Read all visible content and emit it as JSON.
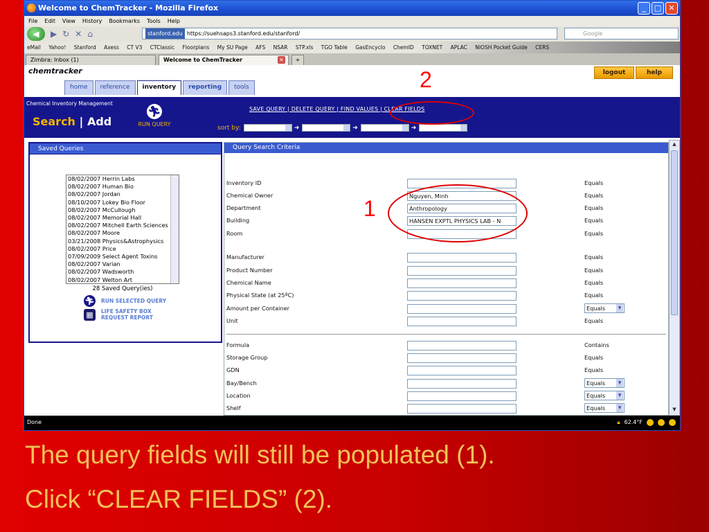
{
  "browser": {
    "title": "Welcome to ChemTracker - Mozilla Firefox",
    "menus": [
      "File",
      "Edit",
      "View",
      "History",
      "Bookmarks",
      "Tools",
      "Help"
    ],
    "url_chip": "stanford.edu",
    "url": "https://suehsaps3.stanford.edu/stanford/",
    "search_placeholder": "Google",
    "bookmarks": [
      "eMail",
      "Yahoo!",
      "Stanford",
      "Axess",
      "CT V3",
      "CTClassic",
      "Floorplans",
      "My SU Page",
      "AFS",
      "NSAR",
      "STP.xls",
      "TGO Table",
      "GasEncyclo",
      "ChemID",
      "TOXNET",
      "APLAC",
      "NIOSH Pocket Guide",
      "CERS"
    ],
    "tabs": [
      {
        "label": "Zimbra: Inbox (1)"
      },
      {
        "label": "Welcome to ChemTracker"
      }
    ],
    "status": "Done",
    "temperature": "62.4°F"
  },
  "app": {
    "logo": "chemtracker",
    "tabs": [
      "home",
      "reference",
      "inventory",
      "reporting",
      "tools"
    ],
    "logout": "logout",
    "help": "help",
    "section_title": "Chemical Inventory Management",
    "search": "Search",
    "separator": "|",
    "add": "Add",
    "run_query": "RUN QUERY",
    "links": "SAVE QUERY | DELETE QUERY | FIND VALUES | CLEAR FIELDS",
    "sort_by": "sort by:"
  },
  "saved_queries": {
    "header": "Saved Queries",
    "items": [
      "08/02/2007 Herrin Labs",
      "08/02/2007 Human Bio",
      "08/02/2007 Jordan",
      "08/10/2007 Lokey Bio Floor",
      "08/02/2007 McCullough",
      "08/02/2007 Memorial Hall",
      "08/02/2007 Mitchell Earth Sciences",
      "08/02/2007 Moore",
      "03/21/2008 Physics&Astrophysics",
      "08/02/2007 Price",
      "07/09/2009 Select Agent Toxins",
      "08/02/2007 Varian",
      "08/02/2007 Wadsworth",
      "08/02/2007 Welton Art"
    ],
    "count": "28 Saved Query(ies)",
    "run_selected": "RUN SELECTED QUERY",
    "life_safety_1": "LIFE SAFETY BOX",
    "life_safety_2": "REQUEST REPORT"
  },
  "criteria": {
    "header": "Query Search Criteria",
    "rows": [
      {
        "label": "Inventory ID",
        "value": "",
        "op": "Equals"
      },
      {
        "label": "Chemical Owner",
        "value": "Nguyen, Minh",
        "op": "Equals"
      },
      {
        "label": "Department",
        "value": "Anthropology",
        "op": "Equals"
      },
      {
        "label": "Building",
        "value": "HANSEN EXPTL PHYSICS LAB - N",
        "op": "Equals"
      },
      {
        "label": "Room",
        "value": "",
        "op": "Equals"
      },
      {
        "label": "Manufacturer",
        "value": "",
        "op": "Equals"
      },
      {
        "label": "Product Number",
        "value": "",
        "op": "Equals"
      },
      {
        "label": "Chemical Name",
        "value": "",
        "op": "Equals"
      },
      {
        "label": "Physical State (at 25ºC)",
        "value": "",
        "op": "Equals"
      },
      {
        "label": "Amount per Container",
        "value": "",
        "op": "Equals"
      },
      {
        "label": "Unit",
        "value": "",
        "op": "Equals"
      },
      {
        "label": "Formula",
        "value": "",
        "op": "Contains"
      },
      {
        "label": "Storage Group",
        "value": "",
        "op": "Equals"
      },
      {
        "label": "GDN",
        "value": "",
        "op": "Equals"
      },
      {
        "label": "Bay/Bench",
        "value": "",
        "op": "Equals"
      },
      {
        "label": "Location",
        "value": "",
        "op": "Equals"
      },
      {
        "label": "Shelf",
        "value": "",
        "op": "Equals"
      }
    ]
  },
  "annotations": {
    "one": "1",
    "two": "2",
    "color": "#e00000"
  },
  "caption": {
    "line1": "The query fields will still be populated (1).",
    "line2": "Click “CLEAR FIELDS” (2)."
  }
}
